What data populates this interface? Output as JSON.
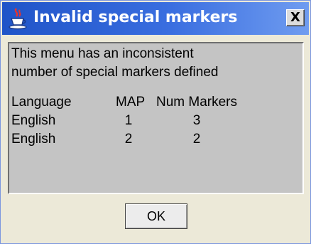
{
  "window": {
    "title": "Invalid special markers",
    "close_label": "X"
  },
  "message": {
    "lines": [
      "This menu has an inconsistent",
      "number of special markers defined"
    ]
  },
  "table": {
    "headers": [
      "Language",
      "MAP",
      "Num Markers"
    ],
    "rows": [
      [
        "English",
        "1",
        "3"
      ],
      [
        "English",
        "2",
        "2"
      ]
    ]
  },
  "buttons": {
    "ok_label": "OK"
  },
  "colors": {
    "titlebar": "#2a5fd6",
    "panel": "#c4c4c4",
    "dialog": "#ece9d8"
  },
  "icons": {
    "app": "java-coffee-cup-icon",
    "close": "close-icon"
  }
}
